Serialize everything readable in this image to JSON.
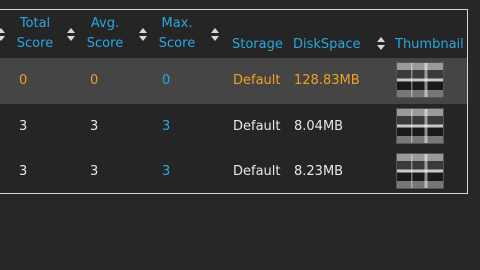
{
  "columns": {
    "total_score": [
      "Total",
      "Score"
    ],
    "avg_score": [
      "Avg.",
      "Score"
    ],
    "max_score": [
      "Max.",
      "Score"
    ],
    "storage": "Storage",
    "diskspace": "DiskSpace",
    "thumbnail": "Thumbnail"
  },
  "rows": [
    {
      "total": "0",
      "avg": "0",
      "max": "0",
      "storage": "Default",
      "disk": "128.83MB",
      "thumb_icon": "thumbnail-image",
      "selected": true
    },
    {
      "total": "3",
      "avg": "3",
      "max": "3",
      "storage": "Default",
      "disk": "8.04MB",
      "thumb_icon": "thumbnail-image",
      "selected": false
    },
    {
      "total": "3",
      "avg": "3",
      "max": "3",
      "storage": "Default",
      "disk": "8.23MB",
      "thumb_icon": "thumbnail-image",
      "selected": false
    }
  ],
  "colors": {
    "accent": "#29a8e0",
    "highlight": "#f0a020",
    "background": "#272727",
    "selected_row": "#454545"
  }
}
